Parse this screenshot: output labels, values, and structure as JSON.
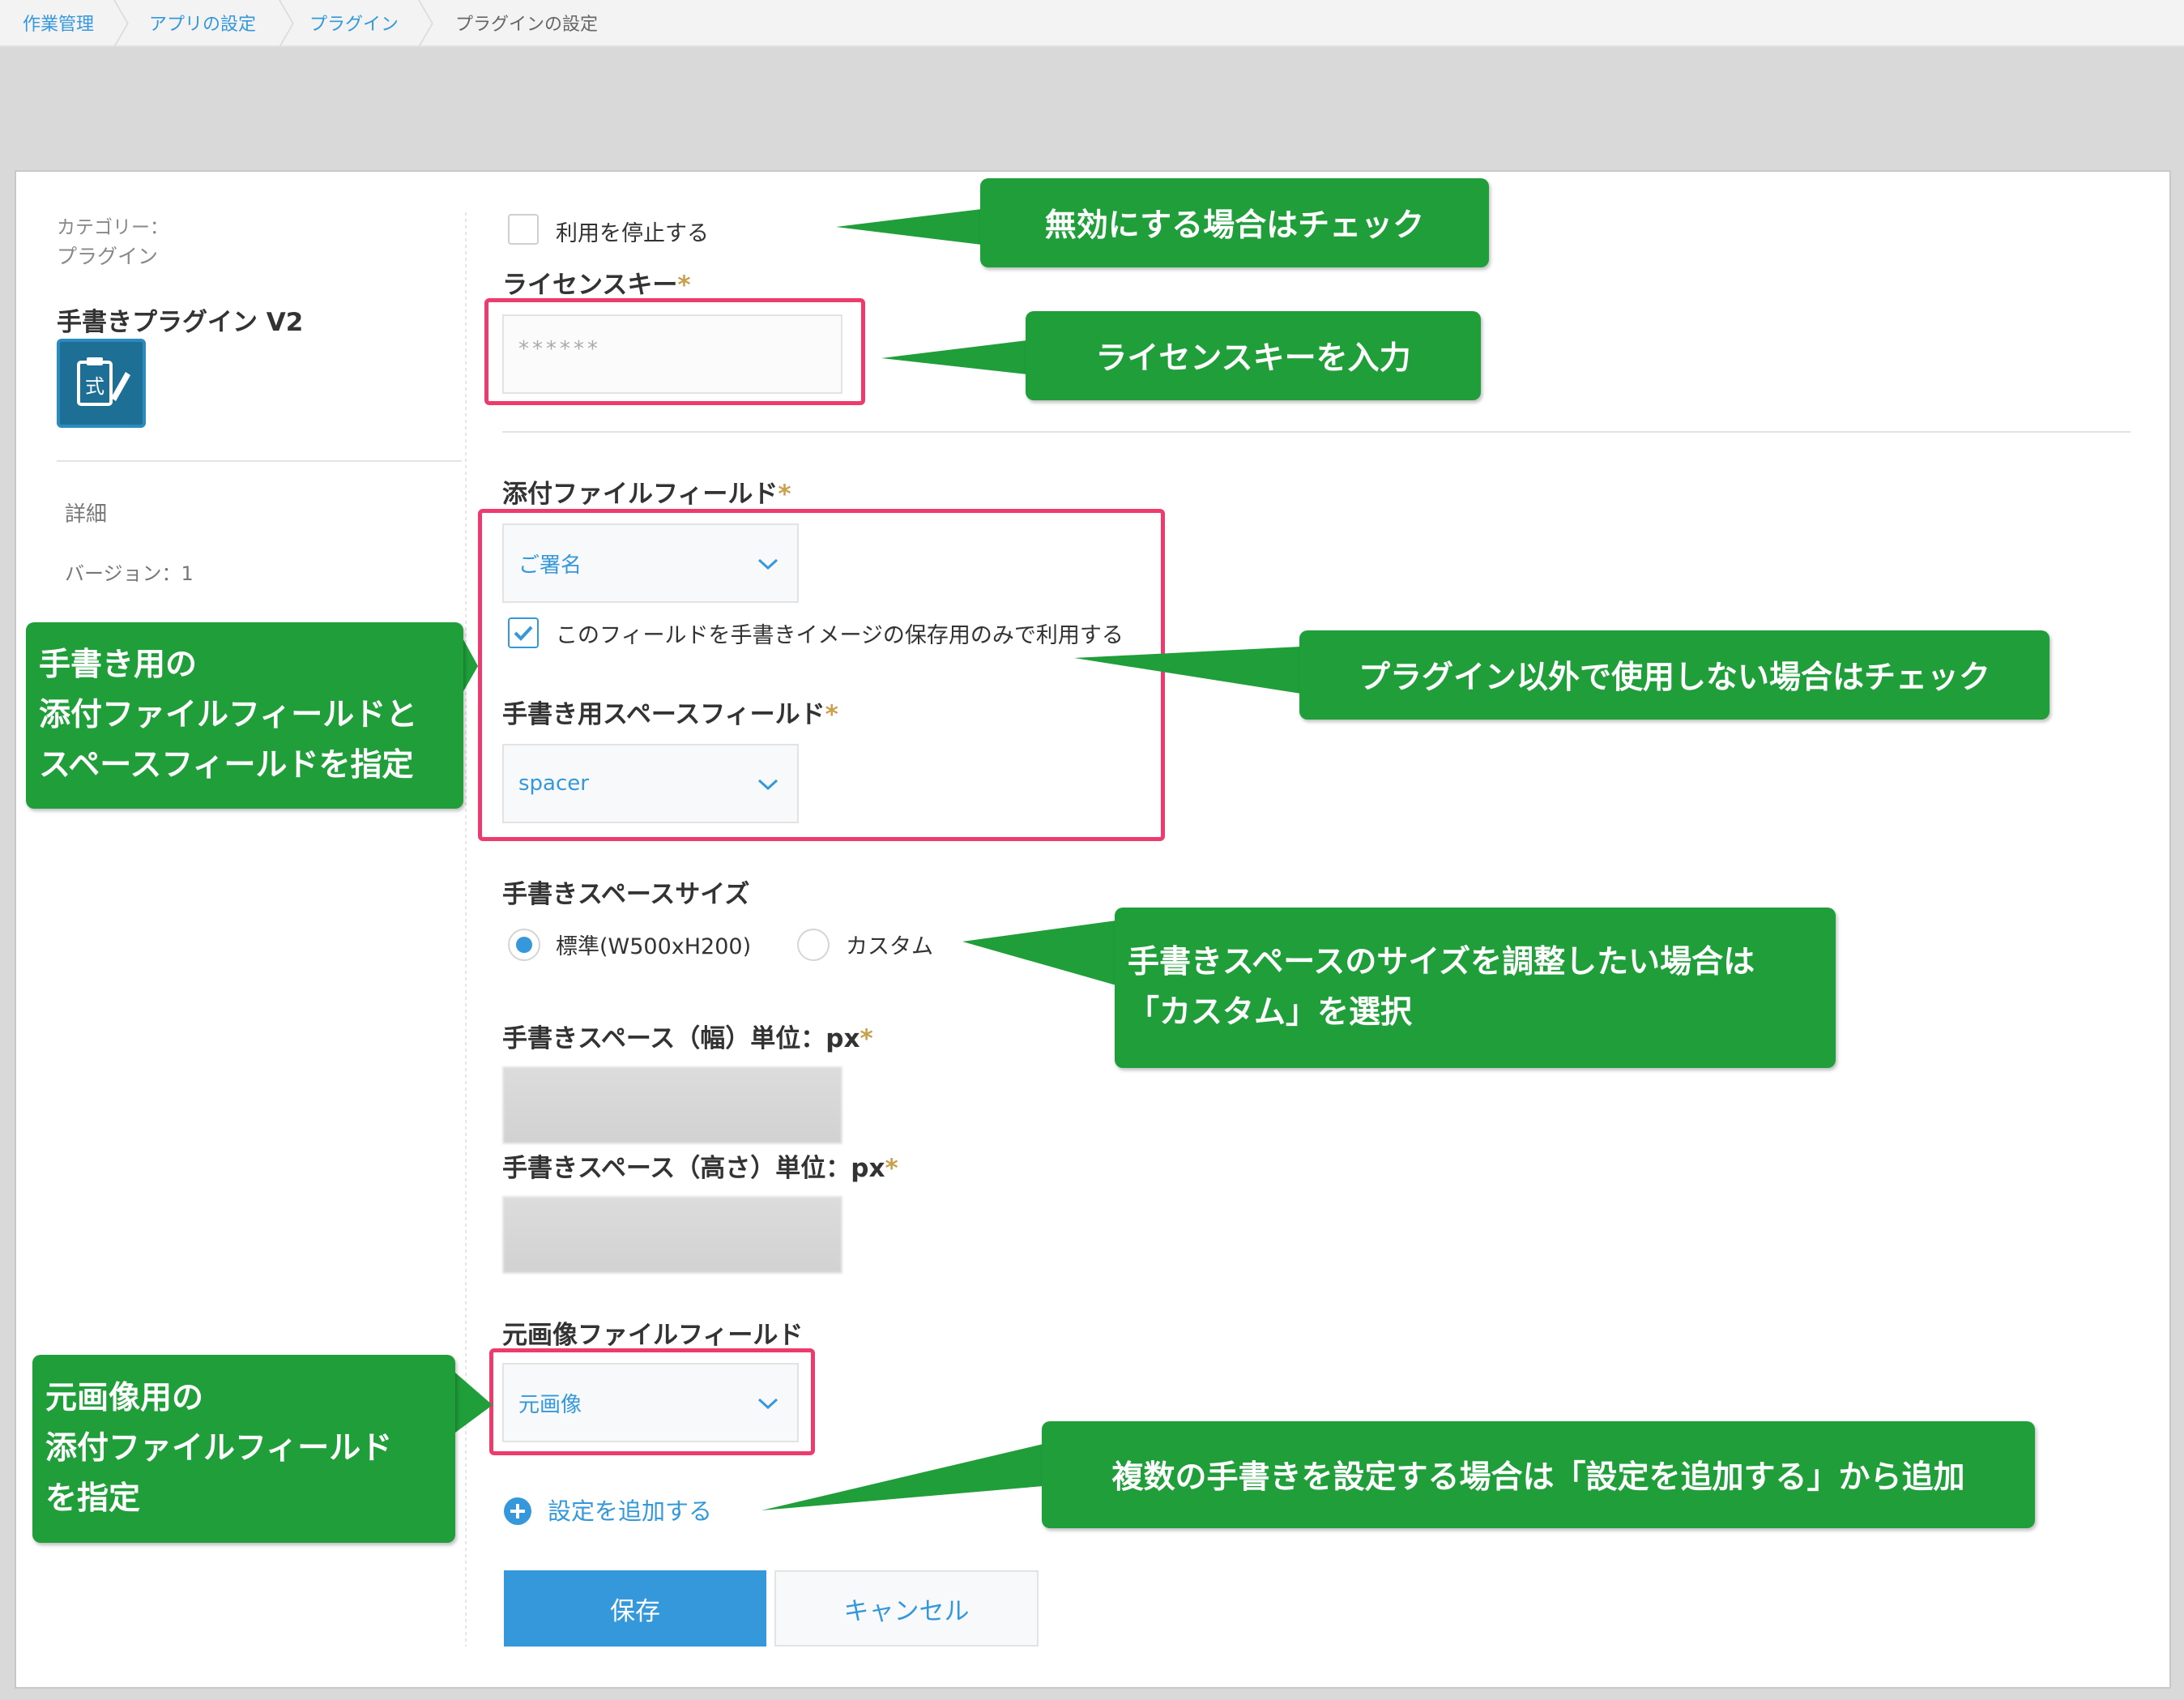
{
  "breadcrumb": [
    "作業管理",
    "アプリの設定",
    "プラグイン",
    "プラグインの設定"
  ],
  "sidebar": {
    "category_label": "カテゴリー：",
    "category_value": "プラグイン",
    "plugin_title": "手書きプラグイン V2",
    "details_link": "詳細",
    "version": "バージョン：1"
  },
  "form": {
    "disable_label": "利用を停止する",
    "license_label": "ライセンスキー",
    "license_placeholder": "******",
    "attach_field_label": "添付ファイルフィールド",
    "attach_field_value": "ご署名",
    "attach_only_label": "このフィールドを手書きイメージの保存用のみで利用する",
    "space_field_label": "手書き用スペースフィールド",
    "space_field_value": "spacer",
    "size_label": "手書きスペースサイズ",
    "size_standard": "標準(W500xH200)",
    "size_custom": "カスタム",
    "width_label": "手書きスペース（幅）単位：px",
    "height_label": "手書きスペース（高さ）単位：px",
    "original_field_label": "元画像ファイルフィールド",
    "original_field_value": "元画像",
    "add_setting": "設定を追加する",
    "save_button": "保存",
    "cancel_button": "キャンセル",
    "required_mark": "*"
  },
  "callouts": {
    "disable": "無効にする場合はチェック",
    "license": "ライセンスキーを入力",
    "fields_line1": "手書き用の",
    "fields_line2": "添付ファイルフィールドと",
    "fields_line3": "スペースフィールドを指定",
    "attach_only": "プラグイン以外で使用しない場合はチェック",
    "custom_line1": "手書きスペースのサイズを調整したい場合は",
    "custom_line2": "「カスタム」を選択",
    "original_line1": "元画像用の",
    "original_line2": "添付ファイルフィールド",
    "original_line3": "を指定",
    "add": "複数の手書きを設定する場合は「設定を追加する」から追加"
  },
  "colors": {
    "accent": "#3498db",
    "callout": "#1f9e3a",
    "highlight": "#ee3b6d",
    "required": "#c8a04e"
  }
}
